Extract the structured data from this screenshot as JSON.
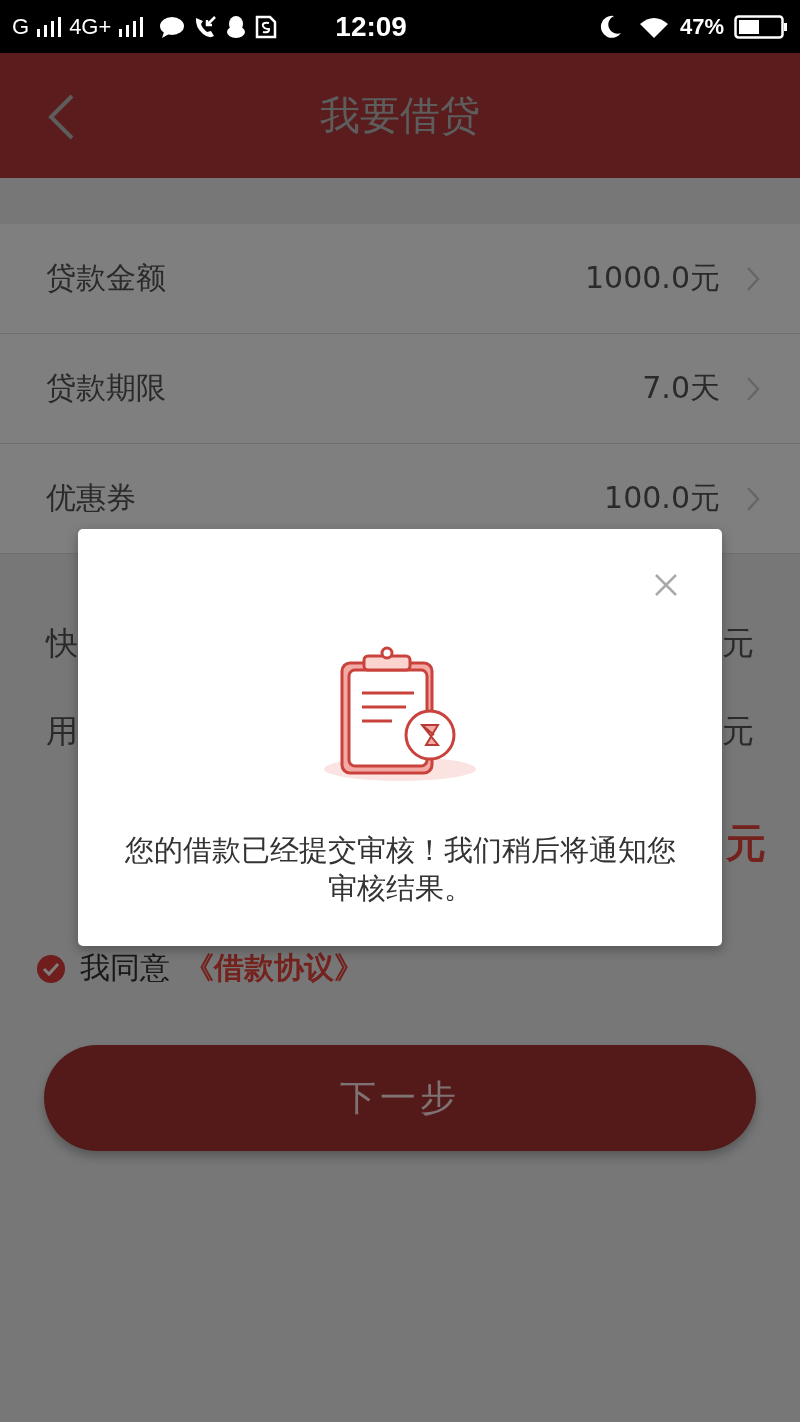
{
  "status_bar": {
    "carrier_1": "G",
    "carrier_2": "4G+",
    "time": "12:09",
    "battery": "47%"
  },
  "header": {
    "title": "我要借贷"
  },
  "form_rows": [
    {
      "label": "贷款金额",
      "value": "1000.0元"
    },
    {
      "label": "贷款期限",
      "value": "7.0天"
    },
    {
      "label": "优惠券",
      "value": "100.0元"
    }
  ],
  "fee_rows": [
    {
      "label": "快",
      "value": "元"
    },
    {
      "label": "用",
      "value": "元"
    }
  ],
  "total": {
    "value": "元"
  },
  "agreement": {
    "checked": true,
    "text": "我同意",
    "link": "《借款协议》"
  },
  "next_button": {
    "label": "下一步"
  },
  "dialog": {
    "message": "您的借款已经提交审核！我们稍后将通知您审核结果。"
  }
}
